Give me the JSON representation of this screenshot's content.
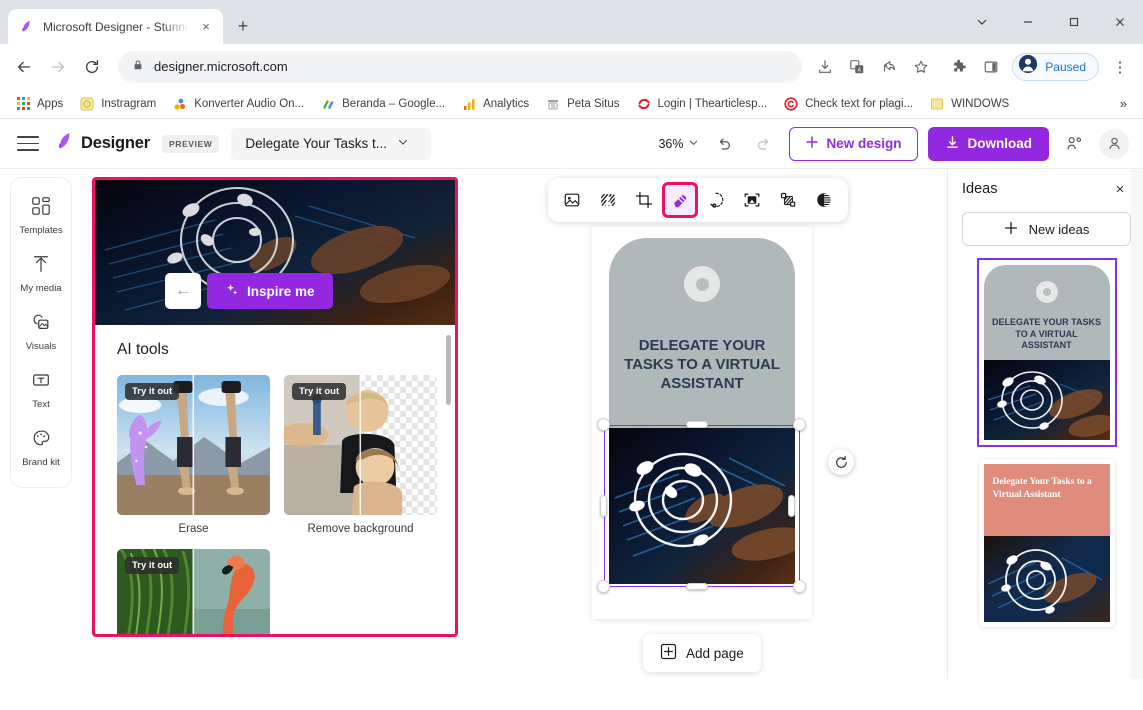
{
  "browser": {
    "tab": {
      "title": "Microsoft Designer - Stunning d",
      "favicon": "designer-logo-icon",
      "close": "×"
    },
    "new_tab_label": "+",
    "window_controls": [
      "chevron-down",
      "minimize",
      "maximize",
      "close"
    ],
    "nav": {
      "back": "←",
      "forward": "→",
      "reload": "↻"
    },
    "omnibox": {
      "url": "designer.microsoft.com",
      "lock": "lock-icon"
    },
    "toolbar_right": [
      "install-icon",
      "translate-icon",
      "share-icon",
      "bookmark-star-icon",
      "extensions-icon",
      "side-panel-icon"
    ],
    "paused_badge": {
      "label": "Paused"
    },
    "menu": "⋮",
    "bookmarks": [
      {
        "label": "Apps",
        "icon": "apps-grid-icon"
      },
      {
        "label": "Instragram",
        "icon": "instagram-icon"
      },
      {
        "label": "Konverter Audio On...",
        "icon": "audio-converter-icon"
      },
      {
        "label": "Beranda – Google...",
        "icon": "google-icon"
      },
      {
        "label": "Analytics",
        "icon": "analytics-icon"
      },
      {
        "label": "Peta Situs",
        "icon": "sitemap-icon"
      },
      {
        "label": "Login | Thearticlesp...",
        "icon": "refresh-red-icon"
      },
      {
        "label": "Check text for plagi...",
        "icon": "copyright-icon"
      },
      {
        "label": "WINDOWS",
        "icon": "folder-icon"
      }
    ],
    "bookmarks_overflow": "»"
  },
  "app": {
    "brand": "Designer",
    "preview_chip": "PREVIEW",
    "document_title": "Delegate Your Tasks t...",
    "zoom": "36%",
    "undo": "undo-icon",
    "redo": "redo-icon",
    "new_design_label": "New design",
    "download_label": "Download",
    "collab_icon": "collaborate-icon",
    "account_icon": "account-icon"
  },
  "rail": {
    "items": [
      {
        "label": "Templates",
        "icon": "templates-icon"
      },
      {
        "label": "My media",
        "icon": "upload-icon"
      },
      {
        "label": "Visuals",
        "icon": "visuals-icon"
      },
      {
        "label": "Text",
        "icon": "text-icon"
      },
      {
        "label": "Brand kit",
        "icon": "brand-kit-icon"
      }
    ]
  },
  "ai_panel": {
    "hero": {
      "back": "←",
      "inspire_label": "Inspire me",
      "sparkle": "sparkle-icon"
    },
    "section_title": "AI tools",
    "try_label": "Try it out",
    "cards": [
      {
        "caption": "Erase",
        "thumb": "erase-before-after"
      },
      {
        "caption": "Remove background",
        "thumb": "remove-bg-before-after"
      },
      {
        "caption": "",
        "thumb": "flamingo-before-after"
      }
    ]
  },
  "float_toolbar": {
    "buttons": [
      {
        "name": "replace-image-icon",
        "selected": false
      },
      {
        "name": "image-effects-icon",
        "selected": false
      },
      {
        "name": "crop-icon",
        "selected": false
      },
      {
        "name": "erase-magic-icon",
        "selected": true
      },
      {
        "name": "generative-erase-icon",
        "selected": false
      },
      {
        "name": "remove-background-icon",
        "selected": false
      },
      {
        "name": "blend-icon",
        "selected": false
      },
      {
        "name": "adjust-contrast-icon",
        "selected": false
      }
    ]
  },
  "canvas": {
    "design_heading": "DELEGATE YOUR TASKS TO A VIRTUAL ASSISTANT",
    "rotate_icon": "rotate-icon",
    "add_page_label": "Add page",
    "add_page_icon": "plus-box-icon"
  },
  "ideas": {
    "title": "Ideas",
    "close": "×",
    "new_ideas_label": "New ideas",
    "cards": [
      {
        "heading": "DELEGATE YOUR TASKS TO A VIRTUAL ASSISTANT",
        "selected": true,
        "style": "tag-gray"
      },
      {
        "heading": "Delegate Your Tasks to a Virtual Assistant",
        "selected": false,
        "style": "salmon-serif"
      }
    ]
  },
  "colors": {
    "accent_purple": "#9229E0",
    "highlight_pink": "#ED1164",
    "selection_purple": "#8B2FE0",
    "browser_chrome": "#dee1e6",
    "tag_gray": "#b0b9ba",
    "heading_navy": "#2a3c52",
    "salmon": "#e08c7d"
  }
}
